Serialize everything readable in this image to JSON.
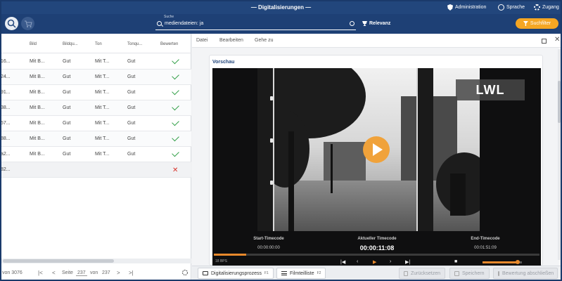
{
  "header": {
    "title": "— Digitalisierungen —",
    "nav": {
      "administration": "Administration",
      "language": "Sprache",
      "access": "Zugang"
    }
  },
  "search": {
    "label": "Suche",
    "value": "mediendateien: ja"
  },
  "sort": {
    "label": "Relevanz"
  },
  "filter": {
    "label": "Suchfilter"
  },
  "table": {
    "columns": [
      "Bild",
      "Bildqu...",
      "Ton",
      "Tonqu...",
      "Bewerten"
    ],
    "rows": [
      {
        "id": "16...",
        "bild": "Mit B...",
        "bildqualitaet": "Gut",
        "ton": "Mit T...",
        "tonqualitaet": "Gut",
        "status": "check"
      },
      {
        "id": "24...",
        "bild": "Mit B...",
        "bildqualitaet": "Gut",
        "ton": "Mit T...",
        "tonqualitaet": "Gut",
        "status": "check"
      },
      {
        "id": "91...",
        "bild": "Mit B...",
        "bildqualitaet": "Gut",
        "ton": "Mit T...",
        "tonqualitaet": "Gut",
        "status": "check"
      },
      {
        "id": "38...",
        "bild": "Mit B...",
        "bildqualitaet": "Gut",
        "ton": "Mit T...",
        "tonqualitaet": "Gut",
        "status": "check"
      },
      {
        "id": "57...",
        "bild": "Mit B...",
        "bildqualitaet": "Gut",
        "ton": "Mit T...",
        "tonqualitaet": "Gut",
        "status": "check"
      },
      {
        "id": "88...",
        "bild": "Mit B...",
        "bildqualitaet": "Gut",
        "ton": "Mit T...",
        "tonqualitaet": "Gut",
        "status": "check"
      },
      {
        "id": "a2...",
        "bild": "Mit B...",
        "bildqualitaet": "Gut",
        "ton": "Mit T...",
        "tonqualitaet": "Gut",
        "status": "check"
      },
      {
        "id": "82...",
        "bild": "",
        "bildqualitaet": "",
        "ton": "",
        "tonqualitaet": "",
        "status": "cross"
      }
    ]
  },
  "pager": {
    "total_text": "von 3076",
    "page_label": "Seite",
    "current": "237",
    "of": "von",
    "total_pages": "237"
  },
  "panel": {
    "menu": [
      "Datei",
      "Bearbeiten",
      "Gehe zu"
    ],
    "preview_title": "Vorschau",
    "logo": "LWL"
  },
  "player": {
    "start_label": "Start-Timecode",
    "start_value": "00:00:00:00",
    "current_label": "Aktueller Timecode",
    "current_value": "00:00:11:08",
    "end_label": "End-Timecode",
    "end_value": "00:01:51:09",
    "fps": "18 BPS",
    "progress_fraction": 0.1,
    "volume_fraction": 0.9
  },
  "bottom": {
    "tab1": "Digitalisierungsprozess",
    "tab1_key": "F1",
    "tab2": "Filmteilliste",
    "tab2_key": "F2",
    "reset": "Zurücksetzen",
    "save": "Speichern",
    "finish": "Bewertung abschließen"
  },
  "colors": {
    "header_bg": "#22467c",
    "accent": "#f5a623",
    "success": "#2f9e44",
    "danger": "#d9342b"
  }
}
